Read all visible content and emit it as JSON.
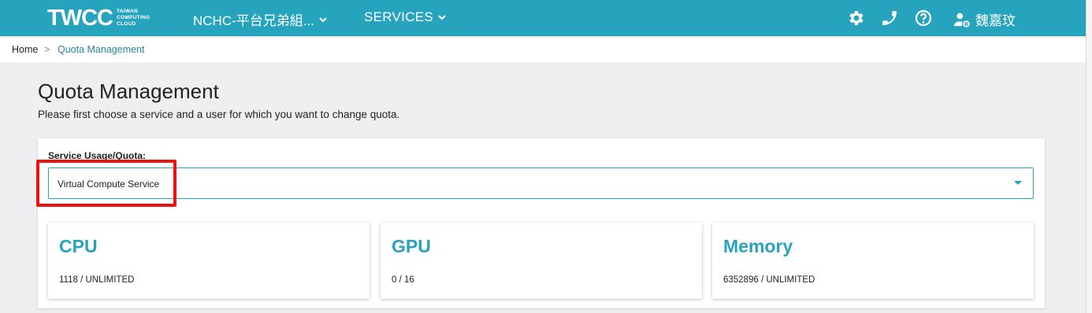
{
  "header": {
    "logo_text": "TWCC",
    "logo_sub": [
      "TAIWAN",
      "COMPUTING",
      "CLOUD"
    ],
    "project_label": "NCHC-平台兄弟組...",
    "services_label": "SERVICES",
    "user_name": "魏嘉玟",
    "icons": [
      "gear-icon",
      "phone-icon",
      "help-icon",
      "user-settings-icon"
    ],
    "bg_color": "#27a4bd"
  },
  "breadcrumb": {
    "home": "Home",
    "separator": ">",
    "current": "Quota Management"
  },
  "page": {
    "title": "Quota Management",
    "description": "Please first choose a service and a user for which you want to change quota."
  },
  "service_select": {
    "label": "Service Usage/Quota:",
    "value": "Virtual Compute Service"
  },
  "quota_cards": [
    {
      "title": "CPU",
      "value": "1118 / UNLIMITED"
    },
    {
      "title": "GPU",
      "value": "0 / 16"
    },
    {
      "title": "Memory",
      "value": "6352896 / UNLIMITED"
    }
  ],
  "colors": {
    "accent": "#27a4bd",
    "highlight": "#ee1111"
  }
}
